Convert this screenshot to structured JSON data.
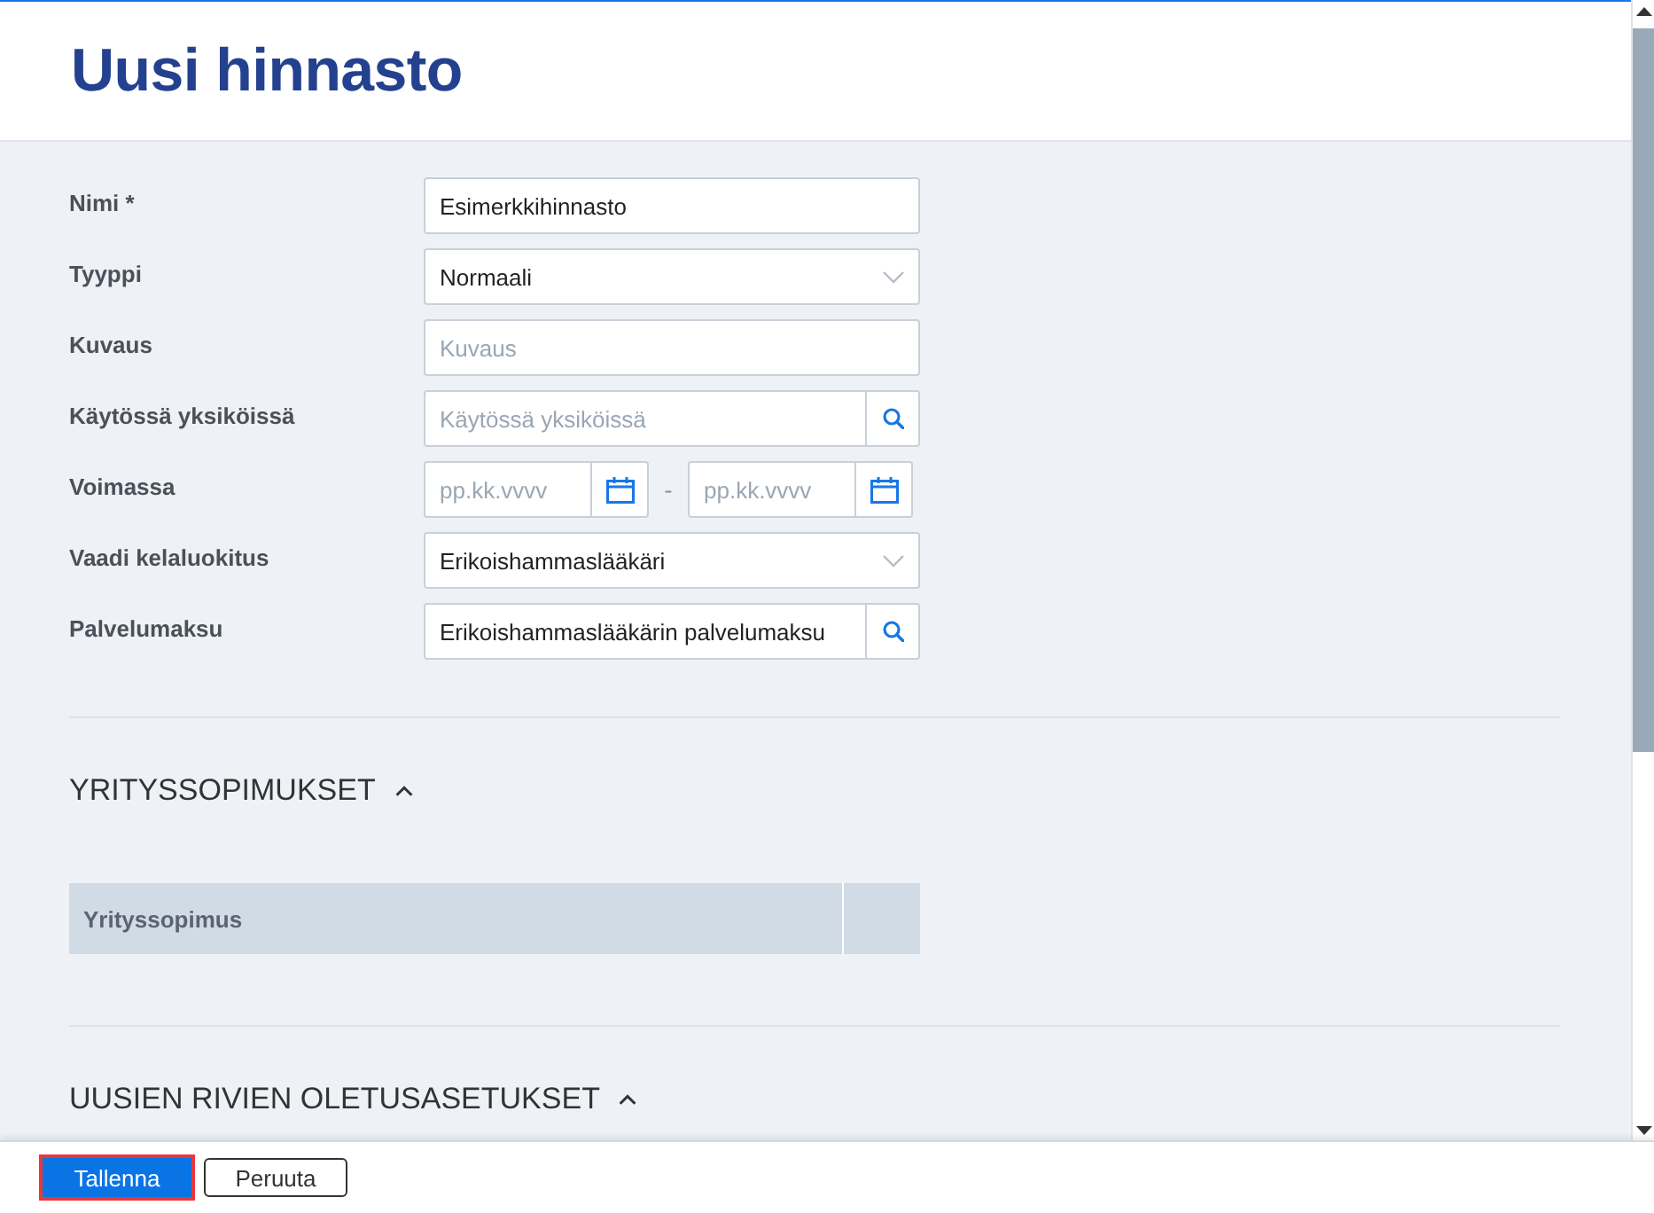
{
  "page": {
    "title": "Uusi hinnasto"
  },
  "form": {
    "fields": [
      {
        "kind": "text",
        "label": "Nimi *",
        "value": "Esimerkkihinnasto"
      },
      {
        "kind": "select",
        "label": "Tyyppi",
        "value": "Normaali"
      },
      {
        "kind": "text",
        "label": "Kuvaus",
        "placeholder": "Kuvaus"
      },
      {
        "kind": "search",
        "label": "Käytössä yksiköissä",
        "placeholder": "Käytössä yksiköissä"
      },
      {
        "kind": "daterange",
        "label": "Voimassa",
        "from": {
          "placeholder": "pp.kk.vvvv"
        },
        "separator": "-",
        "to": {
          "placeholder": "pp.kk.vvvv"
        }
      },
      {
        "kind": "select",
        "label": "Vaadi kelaluokitus",
        "value": "Erikoishammaslääkäri"
      },
      {
        "kind": "search",
        "label": "Palvelumaksu",
        "value": "Erikoishammaslääkärin palvelumaksu"
      }
    ]
  },
  "sections": [
    {
      "title": "YRITYSSOPIMUKSET",
      "expanded": true,
      "table": {
        "columns": [
          "Yrityssopimus"
        ]
      }
    },
    {
      "title": "UUSIEN RIVIEN OLETUSASETUKSET",
      "expanded": true
    }
  ],
  "footer": {
    "buttons": [
      {
        "kind": "primary",
        "label": "Tallenna",
        "focused": true
      },
      {
        "kind": "secondary",
        "label": "Peruuta",
        "focused": false
      }
    ]
  }
}
